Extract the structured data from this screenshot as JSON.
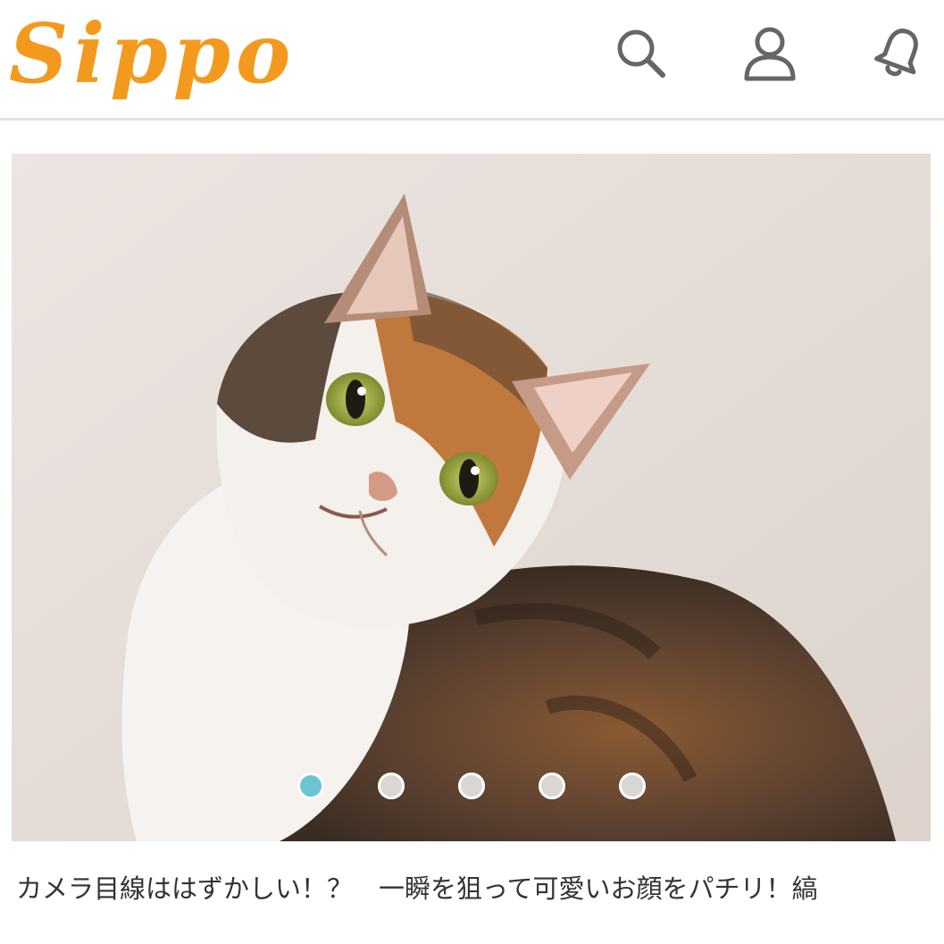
{
  "header": {
    "logo_text": "Sippo",
    "brand_color": "#f39a1e",
    "icons": [
      "search-icon",
      "user-icon",
      "bell-icon"
    ]
  },
  "carousel": {
    "slide_count": 5,
    "active_index": 0,
    "active_color": "#6cc4d2",
    "inactive_color": "#d9d6d3"
  },
  "article": {
    "title": "カメラ目線ははずかしい！？　一瞬を狙って可愛いお顔をパチリ！縞"
  }
}
